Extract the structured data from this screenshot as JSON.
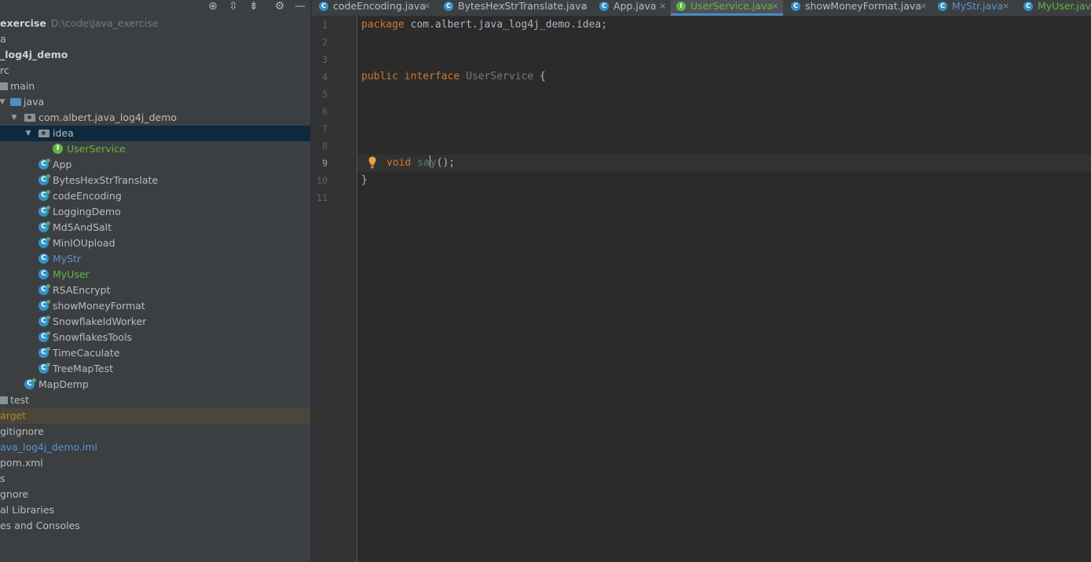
{
  "project": {
    "root_name": "exercise",
    "root_path": "D:\\code\\Java_exercise",
    "tree": [
      {
        "label": "a"
      },
      {
        "label": "_log4j_demo"
      },
      {
        "label": "rc"
      },
      {
        "label": "main"
      },
      {
        "label": "java"
      },
      {
        "label": "com.albert.java_log4j_demo"
      },
      {
        "label": "idea"
      },
      {
        "label": "UserService"
      },
      {
        "label": "App"
      },
      {
        "label": "BytesHexStrTranslate"
      },
      {
        "label": "codeEncoding"
      },
      {
        "label": "LoggingDemo"
      },
      {
        "label": "Md5AndSalt"
      },
      {
        "label": "MinIOUpload"
      },
      {
        "label": "MyStr"
      },
      {
        "label": "MyUser"
      },
      {
        "label": "RSAEncrypt"
      },
      {
        "label": "showMoneyFormat"
      },
      {
        "label": "SnowflakeIdWorker"
      },
      {
        "label": "SnowflakesTools"
      },
      {
        "label": "TimeCaculate"
      },
      {
        "label": "TreeMapTest"
      },
      {
        "label": "MapDemp"
      },
      {
        "label": "test"
      },
      {
        "label": "arget"
      },
      {
        "label": "gitignore"
      },
      {
        "label": "ava_log4j_demo.iml"
      },
      {
        "label": "pom.xml"
      },
      {
        "label": "s"
      },
      {
        "label": "gnore"
      },
      {
        "label": "al Libraries"
      },
      {
        "label": "es and Consoles"
      }
    ]
  },
  "tabs": [
    {
      "label": "codeEncoding.java",
      "close": "×"
    },
    {
      "label": "BytesHexStrTranslate.java",
      "close": "×"
    },
    {
      "label": "App.java",
      "close": "×"
    },
    {
      "label": "UserService.java",
      "close": "×"
    },
    {
      "label": "showMoneyFormat.java",
      "close": "×"
    },
    {
      "label": "MyStr.java",
      "close": "×"
    },
    {
      "label": "MyUser.java",
      "close": "×"
    }
  ],
  "editor": {
    "line_numbers": [
      "1",
      "2",
      "3",
      "4",
      "5",
      "6",
      "7",
      "8",
      "9",
      "10",
      "11"
    ],
    "current_line": 9,
    "code": {
      "l1_kw": "package",
      "l1_rest": " com.albert.java_log4j_demo.idea;",
      "l4_kw1": "public",
      "l4_kw2": "interface",
      "l4_cls": "UserService",
      "l4_rest": " {",
      "l9_kw": "void",
      "l9_m1": "sa",
      "l9_m2": "y",
      "l9_rest": "();",
      "l10": "}"
    }
  },
  "colors": {
    "keyword": "#cc7832",
    "selection": "#0d293e",
    "interface_green": "#62b543",
    "modified_blue": "#5893d4",
    "excluded_olive": "#a9892f"
  }
}
